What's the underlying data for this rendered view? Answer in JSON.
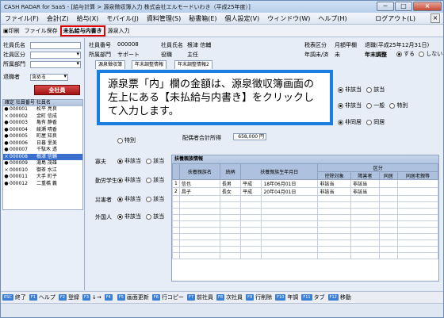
{
  "window": {
    "title": "CASH RADAR for SaaS - [給与計算 > 源泉徴収簿入力 株式会社エルモードいわき（平成25年度）]",
    "min": "─",
    "max": "□",
    "close": "×"
  },
  "menu": [
    "ファイル(F)",
    "会計(Z)",
    "給与(X)",
    "モバイル(J)",
    "資料管理(S)",
    "秘書箱(E)",
    "個人設定(V)",
    "ウィンドウ(W)",
    "ヘルプ(H)"
  ],
  "menu_logout": "ログアウト(L)",
  "menu_close": "×",
  "toolbar": {
    "print": "印刷",
    "file_save": "ファイル保存",
    "hl_button": "未払給与内書き",
    "reflect": "源泉入力"
  },
  "left": {
    "name_label": "社員氏名",
    "class_label": "社員区分",
    "dept_label": "所属部門",
    "retire_label": "退職者",
    "retire_value": "含める",
    "all_job": "全社員",
    "list_header": "確定 社員番号 社員名",
    "employees": [
      {
        "mk": "●",
        "code": "000001",
        "name": "松平 亮良"
      },
      {
        "mk": "×",
        "code": "000002",
        "name": "金町 信成"
      },
      {
        "mk": "●",
        "code": "000003",
        "name": "亀有 静香"
      },
      {
        "mk": "●",
        "code": "000004",
        "name": "綾瀬 晴香"
      },
      {
        "mk": "●",
        "code": "000005",
        "name": "町屋 知良"
      },
      {
        "mk": "●",
        "code": "000006",
        "name": "日暮 里美"
      },
      {
        "mk": "●",
        "code": "000007",
        "name": "千駄木 透"
      },
      {
        "mk": "×",
        "code": "000008",
        "name": "根津 信輔"
      },
      {
        "mk": "●",
        "code": "000009",
        "name": "湯島 茂雄"
      },
      {
        "mk": "×",
        "code": "000010",
        "name": "御茶 水江"
      },
      {
        "mk": "●",
        "code": "000011",
        "name": "大手 町子"
      },
      {
        "mk": "●",
        "code": "000012",
        "name": "二重橋 義"
      }
    ]
  },
  "main": {
    "emp_no_label": "社員番号",
    "emp_no": "000008",
    "emp_name_label": "社員氏名",
    "emp_name": "根津 信輔",
    "dept_label": "所属部門",
    "dept": "サポート",
    "title_label": "役職",
    "title": "主任",
    "tax_class_label": "税表区分",
    "tax_class": "月額甲欄",
    "adjust_label": "年調未/済",
    "adjust": "未",
    "retire_label": "退職(平成25年12月31日)",
    "year_end_label": "年末調整",
    "year_end_opts": [
      "する",
      "しない"
    ],
    "tab1": "源泉徴収簿",
    "tab2": "年末調整情報",
    "tab3": "年末調整情報2",
    "radio_row1": [
      "非該当",
      "該当"
    ],
    "radio_row2": [
      "非該当",
      "一般",
      "特別"
    ],
    "radio_row3": [
      "非同居",
      "同居"
    ],
    "spouse_special": "特別",
    "spouse_total_label": "配偶者合計所得",
    "spouse_total": "658,000 円",
    "widow_label": "寡夫",
    "working_student_label": "勤労学生",
    "disabled_label": "災害者",
    "foreigner_label": "外国人",
    "na": "非該当",
    "yes": "該当"
  },
  "callout": {
    "text": "源泉票「内」欄の金額は、源泉徴収簿画面の左上にある【未払給与内書き】をクリックして入力します。"
  },
  "dependents": {
    "title": "扶養親族情報",
    "headers": [
      "",
      "扶養親族名",
      "続柄",
      "扶養親族生年月日",
      "控除対象",
      "障害者",
      "同居",
      "同居老親等"
    ],
    "group_header": "区分",
    "rows": [
      {
        "no": "1",
        "name": "信也",
        "rel": "長男",
        "era": "平成",
        "date": "18年06月01日",
        "c1": "非該当",
        "c2": "非該当"
      },
      {
        "no": "2",
        "name": "昌子",
        "rel": "長女",
        "era": "平成",
        "date": "20年04月01日",
        "c1": "非該当",
        "c2": "非該当"
      }
    ]
  },
  "fkeys": [
    {
      "k": "ESC",
      "label": "終了"
    },
    {
      "k": "F1",
      "label": "ヘルプ"
    },
    {
      "k": "F2",
      "label": "登録"
    },
    {
      "k": "F3",
      "label": "↓→"
    },
    {
      "k": "F4",
      "label": ""
    },
    {
      "k": "F5",
      "label": "画面更新"
    },
    {
      "k": "F6",
      "label": "行コピー"
    },
    {
      "k": "F7",
      "label": "前社員"
    },
    {
      "k": "F8",
      "label": "次社員"
    },
    {
      "k": "F9",
      "label": "行削除"
    },
    {
      "k": "F10",
      "label": "年調"
    },
    {
      "k": "F11",
      "label": "タブ"
    },
    {
      "k": "F12",
      "label": "移動"
    }
  ]
}
